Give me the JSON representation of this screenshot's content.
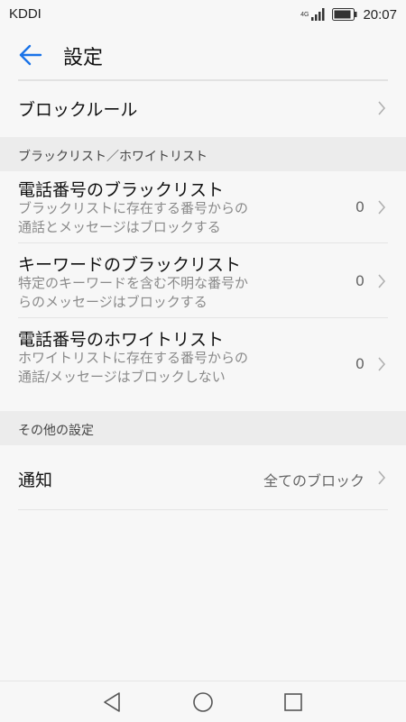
{
  "status_bar": {
    "carrier": "KDDI",
    "network": "4G",
    "time": "20:07"
  },
  "app_bar": {
    "title": "設定"
  },
  "block_rules": {
    "label": "ブロックルール"
  },
  "sections": {
    "lists_header": "ブラックリスト／ホワイトリスト",
    "other_header": "その他の設定"
  },
  "phone_blacklist": {
    "title": "電話番号のブラックリスト",
    "subtitle": "ブラックリストに存在する番号からの通話とメッセージはブロックする",
    "value": "0"
  },
  "keyword_blacklist": {
    "title": "キーワードのブラックリスト",
    "subtitle": "特定のキーワードを含む不明な番号からのメッセージはブロックする",
    "value": "0"
  },
  "phone_whitelist": {
    "title": "電話番号のホワイトリスト",
    "subtitle": "ホワイトリストに存在する番号からの通話/メッセージはブロックしない",
    "value": "0"
  },
  "notification": {
    "label": "通知",
    "value": "全てのブロック"
  },
  "colors": {
    "accent": "#1a73e8",
    "background": "#f7f7f7",
    "section": "#ececec"
  }
}
